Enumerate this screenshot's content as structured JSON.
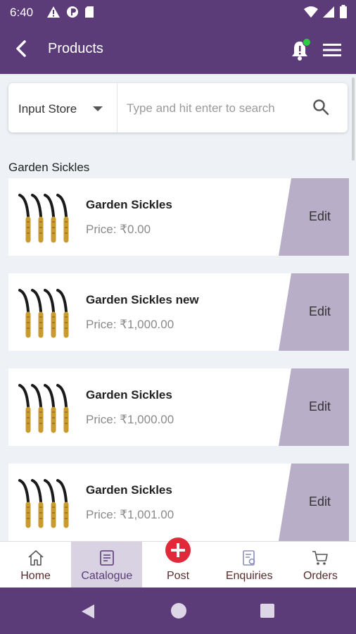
{
  "status": {
    "time": "6:40"
  },
  "appbar": {
    "title": "Products"
  },
  "search": {
    "store_label": "Input Store",
    "placeholder": "Type and hit enter to search"
  },
  "section": {
    "title": "Garden Sickles"
  },
  "products": [
    {
      "name": "Garden Sickles",
      "price": "Price: ₹0.00",
      "edit": "Edit"
    },
    {
      "name": "Garden Sickles new",
      "price": "Price: ₹1,000.00",
      "edit": "Edit"
    },
    {
      "name": "Garden Sickles",
      "price": "Price: ₹1,000.00",
      "edit": "Edit"
    },
    {
      "name": "Garden Sickles",
      "price": "Price: ₹1,001.00",
      "edit": "Edit"
    }
  ],
  "tabs": [
    {
      "label": "Home",
      "icon": "home-icon"
    },
    {
      "label": "Catalogue",
      "icon": "catalogue-icon",
      "active": true
    },
    {
      "label": "Post",
      "icon": "add-circle-icon"
    },
    {
      "label": "Enquiries",
      "icon": "enquiries-icon"
    },
    {
      "label": "Orders",
      "icon": "cart-icon"
    }
  ],
  "colors": {
    "brand": "#5b3b78",
    "edit_bg": "#b8aec8",
    "post_red": "#e02a3a",
    "notification_dot": "#2ecc40"
  }
}
